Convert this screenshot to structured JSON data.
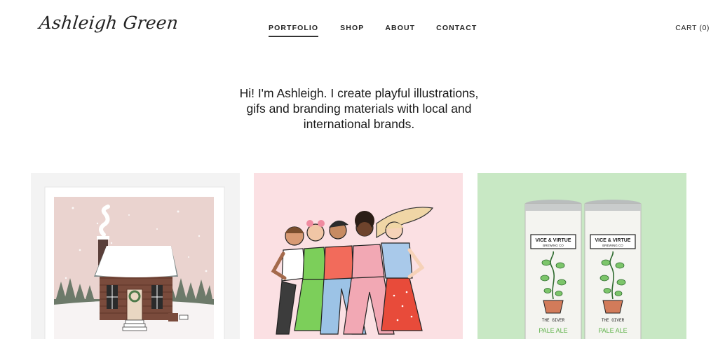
{
  "site": {
    "logo": "Ashleigh Green"
  },
  "nav": {
    "items": [
      {
        "label": "PORTFOLIO",
        "active": true
      },
      {
        "label": "SHOP"
      },
      {
        "label": "ABOUT"
      },
      {
        "label": "CONTACT"
      }
    ]
  },
  "cart": {
    "label": "CART (0)"
  },
  "intro": {
    "lines": [
      "Hi! I'm Ashleigh. I create playful illustrations,",
      "gifs and branding materials with local and",
      "international brands."
    ]
  },
  "gallery": {
    "items": [
      {
        "name": "cabin-print",
        "bg": "#f3f3f3"
      },
      {
        "name": "women-group-illustration",
        "bg": "#fbe0e3"
      },
      {
        "name": "pale-ale-cans",
        "bg": "#c8e8c4",
        "can_brand": "VICE & VIRTUE",
        "can_sub": "BREWING CO",
        "can_title": "THE GIVER",
        "can_style": "PALE ALE"
      }
    ]
  },
  "colors": {
    "text": "#1a1a1a",
    "nav_active_underline": "#333333",
    "tile2_bg": "#fbe0e3",
    "tile3_bg": "#c8e8c4"
  }
}
